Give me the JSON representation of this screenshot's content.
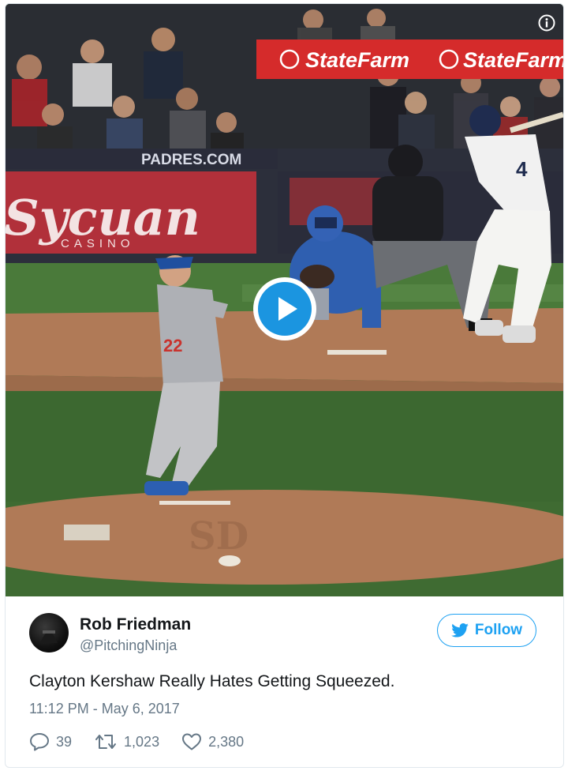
{
  "media": {
    "banner_brand_1": "StateFarm",
    "banner_brand_2": "StateFarm",
    "wall_sign": "PADRES.COM",
    "sponsor_name": "Sycuan",
    "sponsor_sub": "CASINO",
    "pitcher_number": "22",
    "batter_number": "4",
    "play_icon": "play-icon",
    "info_icon": "info-icon",
    "colors": {
      "play_blue": "#1b95e0",
      "grass": "#3f6b32",
      "dirt": "#b07a57"
    }
  },
  "tweet": {
    "author_name": "Rob Friedman",
    "author_handle": "@PitchingNinja",
    "follow_label": "Follow",
    "text": "Clayton Kershaw Really Hates Getting Squeezed.",
    "timestamp": "11:12 PM - May 6, 2017",
    "replies": "39",
    "retweets": "1,023",
    "likes": "2,380",
    "colors": {
      "accent": "#1da1f2",
      "secondary_text": "#657786"
    }
  }
}
